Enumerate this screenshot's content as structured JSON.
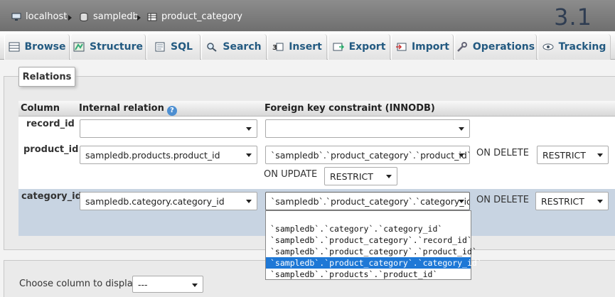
{
  "breadcrumb": {
    "server": "localhost",
    "database": "sampledb",
    "table": "product_category"
  },
  "version": "3.1",
  "tabs": [
    {
      "label": "Browse",
      "icon": "browse-icon"
    },
    {
      "label": "Structure",
      "icon": "structure-icon"
    },
    {
      "label": "SQL",
      "icon": "sql-icon"
    },
    {
      "label": "Search",
      "icon": "search-icon"
    },
    {
      "label": "Insert",
      "icon": "insert-icon"
    },
    {
      "label": "Export",
      "icon": "export-icon"
    },
    {
      "label": "Import",
      "icon": "import-icon"
    },
    {
      "label": "Operations",
      "icon": "operations-icon"
    },
    {
      "label": "Tracking",
      "icon": "tracking-icon"
    }
  ],
  "relations": {
    "legend": "Relations",
    "headers": {
      "column": "Column",
      "internal": "Internal relation",
      "foreign": "Foreign key constraint (INNODB)"
    },
    "rows": [
      {
        "column": "record_id",
        "internal": "",
        "foreign": ""
      },
      {
        "column": "product_id",
        "internal": "sampledb.products.product_id",
        "foreign": "`sampledb`.`product_category`.`product_id`",
        "on_delete_label": "ON DELETE",
        "on_delete": "RESTRICT",
        "on_update_label": "ON UPDATE",
        "on_update": "RESTRICT"
      },
      {
        "column": "category_id",
        "internal": "sampledb.category.category_id",
        "foreign": "`sampledb`.`product_category`.`category_id`",
        "on_delete_label": "ON DELETE",
        "on_delete": "RESTRICT"
      }
    ],
    "dropdown_options": [
      "`sampledb`.`category`.`category_id`",
      "`sampledb`.`product_category`.`record_id`",
      "`sampledb`.`product_category`.`product_id`",
      "`sampledb`.`product_category`.`category_id`",
      "`sampledb`.`products`.`product_id`"
    ],
    "dropdown_selected_index": 3
  },
  "display": {
    "label": "Choose column to display:",
    "value": "---"
  },
  "colors": {
    "topbar": "#7a7a7a",
    "tab_text": "#235a81",
    "row_highlight": "#c8d4e2",
    "selected_option": "#1e78d6"
  }
}
